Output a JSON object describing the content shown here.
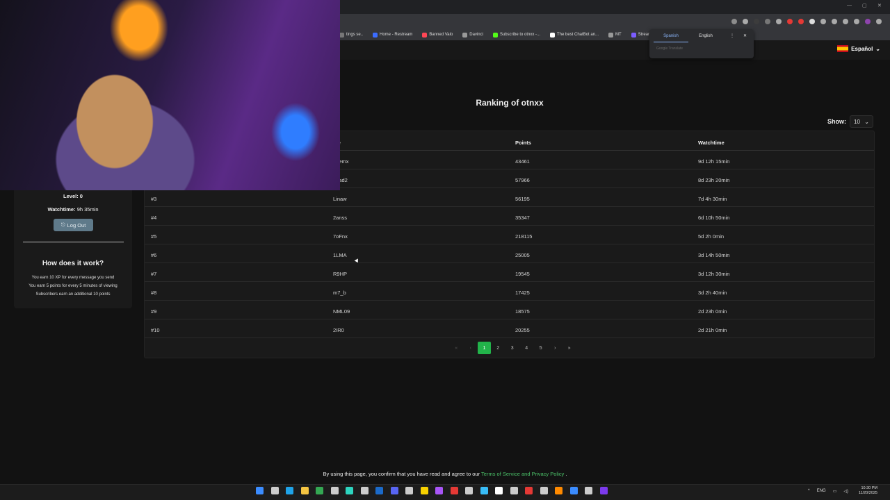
{
  "browser": {
    "bookmarks": [
      {
        "label": "tings se..",
        "color": "#777"
      },
      {
        "label": "Home - Restream",
        "color": "#3b6cff"
      },
      {
        "label": "Banned Valo",
        "color": "#ff4655"
      },
      {
        "label": "Davinci",
        "color": "#999"
      },
      {
        "label": "Subscribe to otnxx -...",
        "color": "#53fc18"
      },
      {
        "label": "The best ChatBot an...",
        "color": "#ffffff"
      },
      {
        "label": "MT",
        "color": "#999"
      },
      {
        "label": "StreamLadder | Edit...",
        "color": "#7b5cff"
      }
    ],
    "translate": {
      "tab_active": "Spanish",
      "tab_other": "English",
      "footer": "Google Translate",
      "more": "⋮",
      "close": "✕"
    }
  },
  "site": {
    "language": "Español",
    "title": "Ranking of otnxx",
    "show_label": "Show:",
    "show_value": "10",
    "columns": [
      "me",
      "Points",
      "Watchtime"
    ],
    "rows": [
      {
        "rank": "",
        "name": "7eemx",
        "points": "43461",
        "watchtime": "9d 12h 15min"
      },
      {
        "rank": "",
        "name": "ghad2",
        "points": "57966",
        "watchtime": "8d 23h 20min"
      },
      {
        "rank": "#3",
        "name": "Linaw",
        "points": "56195",
        "watchtime": "7d 4h 30min"
      },
      {
        "rank": "#4",
        "name": "2anss",
        "points": "35347",
        "watchtime": "6d 10h 50min"
      },
      {
        "rank": "#5",
        "name": "7oFnx",
        "points": "218115",
        "watchtime": "5d 2h 0min"
      },
      {
        "rank": "#6",
        "name": "1LMA",
        "points": "25005",
        "watchtime": "3d 14h 50min"
      },
      {
        "rank": "#7",
        "name": "R9HP",
        "points": "19545",
        "watchtime": "3d 12h 30min"
      },
      {
        "rank": "#8",
        "name": "m7_b",
        "points": "17425",
        "watchtime": "3d 2h 40min"
      },
      {
        "rank": "#9",
        "name": "NML09",
        "points": "18575",
        "watchtime": "2d 23h 0min"
      },
      {
        "rank": "#10",
        "name": "2IR0",
        "points": "20255",
        "watchtime": "2d 21h 0min"
      }
    ],
    "pagination": {
      "first": "«",
      "prev": "‹",
      "pages": [
        "1",
        "2",
        "3",
        "4",
        "5"
      ],
      "next": "›",
      "last": "»",
      "current": "1"
    },
    "sidebar": {
      "level_label": "Level:",
      "level_value": "0",
      "watchtime_label": "Watchtime:",
      "watchtime_value": "9h 35min",
      "logout": "Log Out",
      "how_title": "How does it work?",
      "how_lines": [
        "You earn 10 XP for every message you send",
        "You earn 5 points for every 5 minutes of viewing",
        "Subscribers earn an additional 10 points"
      ]
    },
    "footer": {
      "text": "By using this page, you confirm that you have read and agree to our",
      "link": "Terms of Service and Privacy Policy",
      "end": "."
    }
  },
  "taskbar": {
    "language": "ENG",
    "time": "10:30 PM",
    "date": "11/20/2025",
    "icon_colors": [
      "#3b8cff",
      "#cccccc",
      "#1fa3e8",
      "#f5c542",
      "#34a853",
      "#cccccc",
      "#2dd4bf",
      "#cccccc",
      "#1b6ac9",
      "#5865f2",
      "#cccccc",
      "#f7d100",
      "#a855f7",
      "#e53935",
      "#cccccc",
      "#38bdf8",
      "#ffffff",
      "#cccccc",
      "#e53935",
      "#cccccc",
      "#ff8a00",
      "#3b8cff",
      "#cccccc",
      "#7c3aed"
    ]
  },
  "colors": {
    "accent": "#22b34a",
    "link": "#4cc46a",
    "logout_bg": "#5f7a8a"
  }
}
